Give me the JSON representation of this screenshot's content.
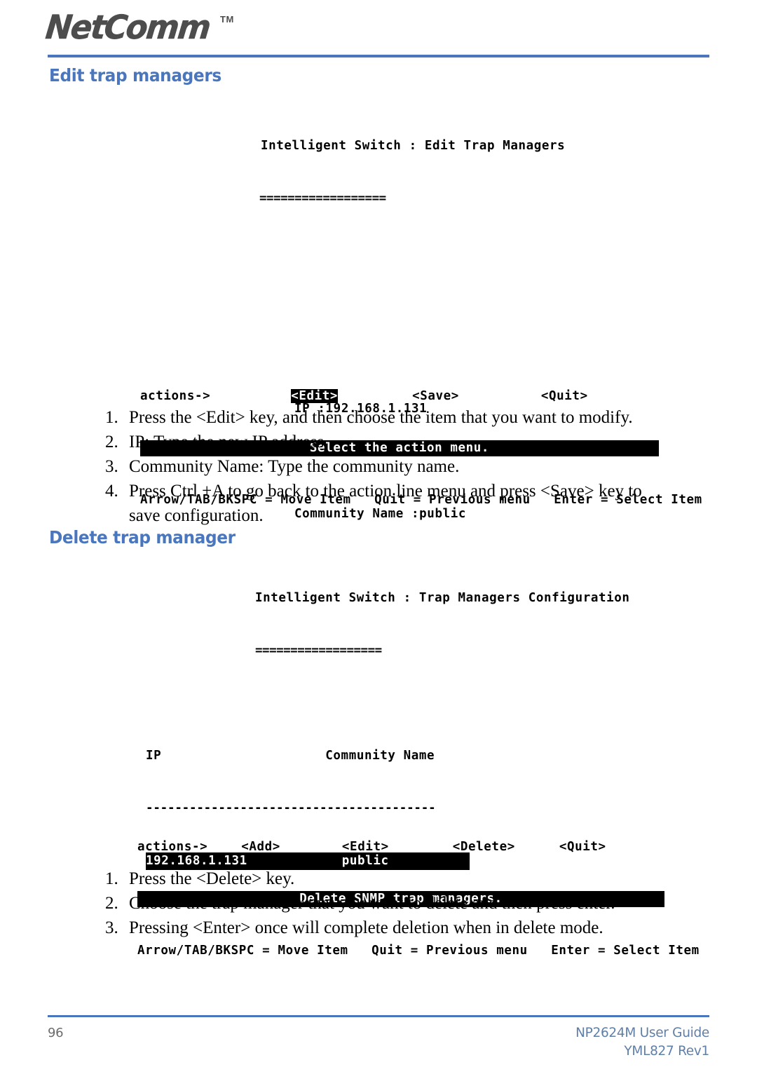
{
  "brand": {
    "logo_text": "NetComm",
    "trademark": "TM"
  },
  "sections": {
    "edit": {
      "heading": "Edit trap managers",
      "terminal": {
        "title": "Intelligent Switch : Edit Trap Managers",
        "title_underline": "==================",
        "ip_label": "IP :192.168.1.131",
        "community_label": "Community Name :public",
        "actions_prefix": "actions->",
        "actions": [
          "<Edit>",
          "<Save>",
          "<Quit>"
        ],
        "highlighted_action": "<Edit>",
        "status_message": "Select the action menu.",
        "hints": "Arrow/TAB/BKSPC = Move Item   Quit = Previous menu   Enter = Select Item"
      },
      "steps": [
        "Press the <Edit> key, and then choose the item that you want to modify.",
        "IP: Type the new IP address",
        "Community Name: Type the community name.",
        "Press Ctrl +A to go back to the action line menu and press <Save> key to save configuration."
      ]
    },
    "delete": {
      "heading": "Delete trap manager",
      "terminal": {
        "title": "Intelligent Switch : Trap Managers Configuration",
        "title_underline": "==================",
        "table": {
          "columns": [
            "IP",
            "Community Name"
          ],
          "separator": "----------------------------------------",
          "rows": [
            {
              "ip": "192.168.1.131",
              "community": "public",
              "selected": true
            }
          ]
        },
        "actions_prefix": "actions->",
        "actions": [
          "<Add>",
          "<Edit>",
          "<Delete>",
          "<Quit>"
        ],
        "highlighted_action": "",
        "status_message": "Delete SNMP trap managers.",
        "hints": "Arrow/TAB/BKSPC = Move Item   Quit = Previous menu   Enter = Select Item"
      },
      "steps": [
        "Press the <Delete> key.",
        "Choose the trap manager that you want to delete and then press enter.",
        "Pressing <Enter> once will complete deletion when in delete mode."
      ]
    }
  },
  "footer": {
    "page_number": "96",
    "guide_title": "NP2624M User Guide",
    "revision": "YML827 Rev1"
  },
  "colors": {
    "accent_blue": "#4a76bd",
    "footer_text": "#5f7fa8",
    "logo_gray": "#4d4d4d"
  }
}
